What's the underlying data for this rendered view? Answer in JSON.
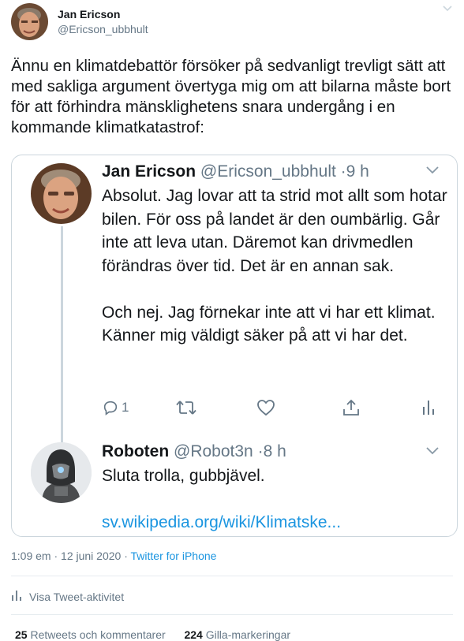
{
  "author": {
    "name": "Jan Ericson",
    "handle": "@Ericson_ubbhult"
  },
  "tweet": {
    "text": "Ännu en klimatdebattör försöker på sedvanligt trevligt sätt att med sakliga argument övertyga mig om att bilarna måste bort för att förhindra mänsklighetens snara undergång i en kommande klimatkatastrof:"
  },
  "quoted": {
    "name": "Jan Ericson",
    "handle": "@Ericson_ubbhult",
    "time": "9 h",
    "text": "Absolut. Jag lovar att ta strid mot allt som hotar bilen. För oss på landet är den oumbärlig. Går inte att leva utan. Däremot kan drivmedlen förändras över tid. Det är en annan sak.\n\nOch nej. Jag förnekar inte att vi har ett klimat. Känner mig väldigt säker på att vi har det.",
    "reply_count": "1"
  },
  "reply": {
    "name": "Roboten",
    "handle": "@Robot3n",
    "time": "8 h",
    "text": "Sluta trolla, gubbjävel.",
    "link": "sv.wikipedia.org/wiki/Klimatske..."
  },
  "meta": {
    "timestamp": "1:09 em · 12 juni 2020 · ",
    "source": "Twitter for iPhone",
    "activity_label": "Visa Tweet-aktivitet"
  },
  "stats": {
    "retweets_count": "25",
    "retweets_label": "Retweets och kommentarer",
    "likes_count": "224",
    "likes_label": "Gilla-markeringar"
  },
  "colors": {
    "link": "#1b95e0",
    "secondary_text": "#657786",
    "border": "#ccd6dd"
  }
}
